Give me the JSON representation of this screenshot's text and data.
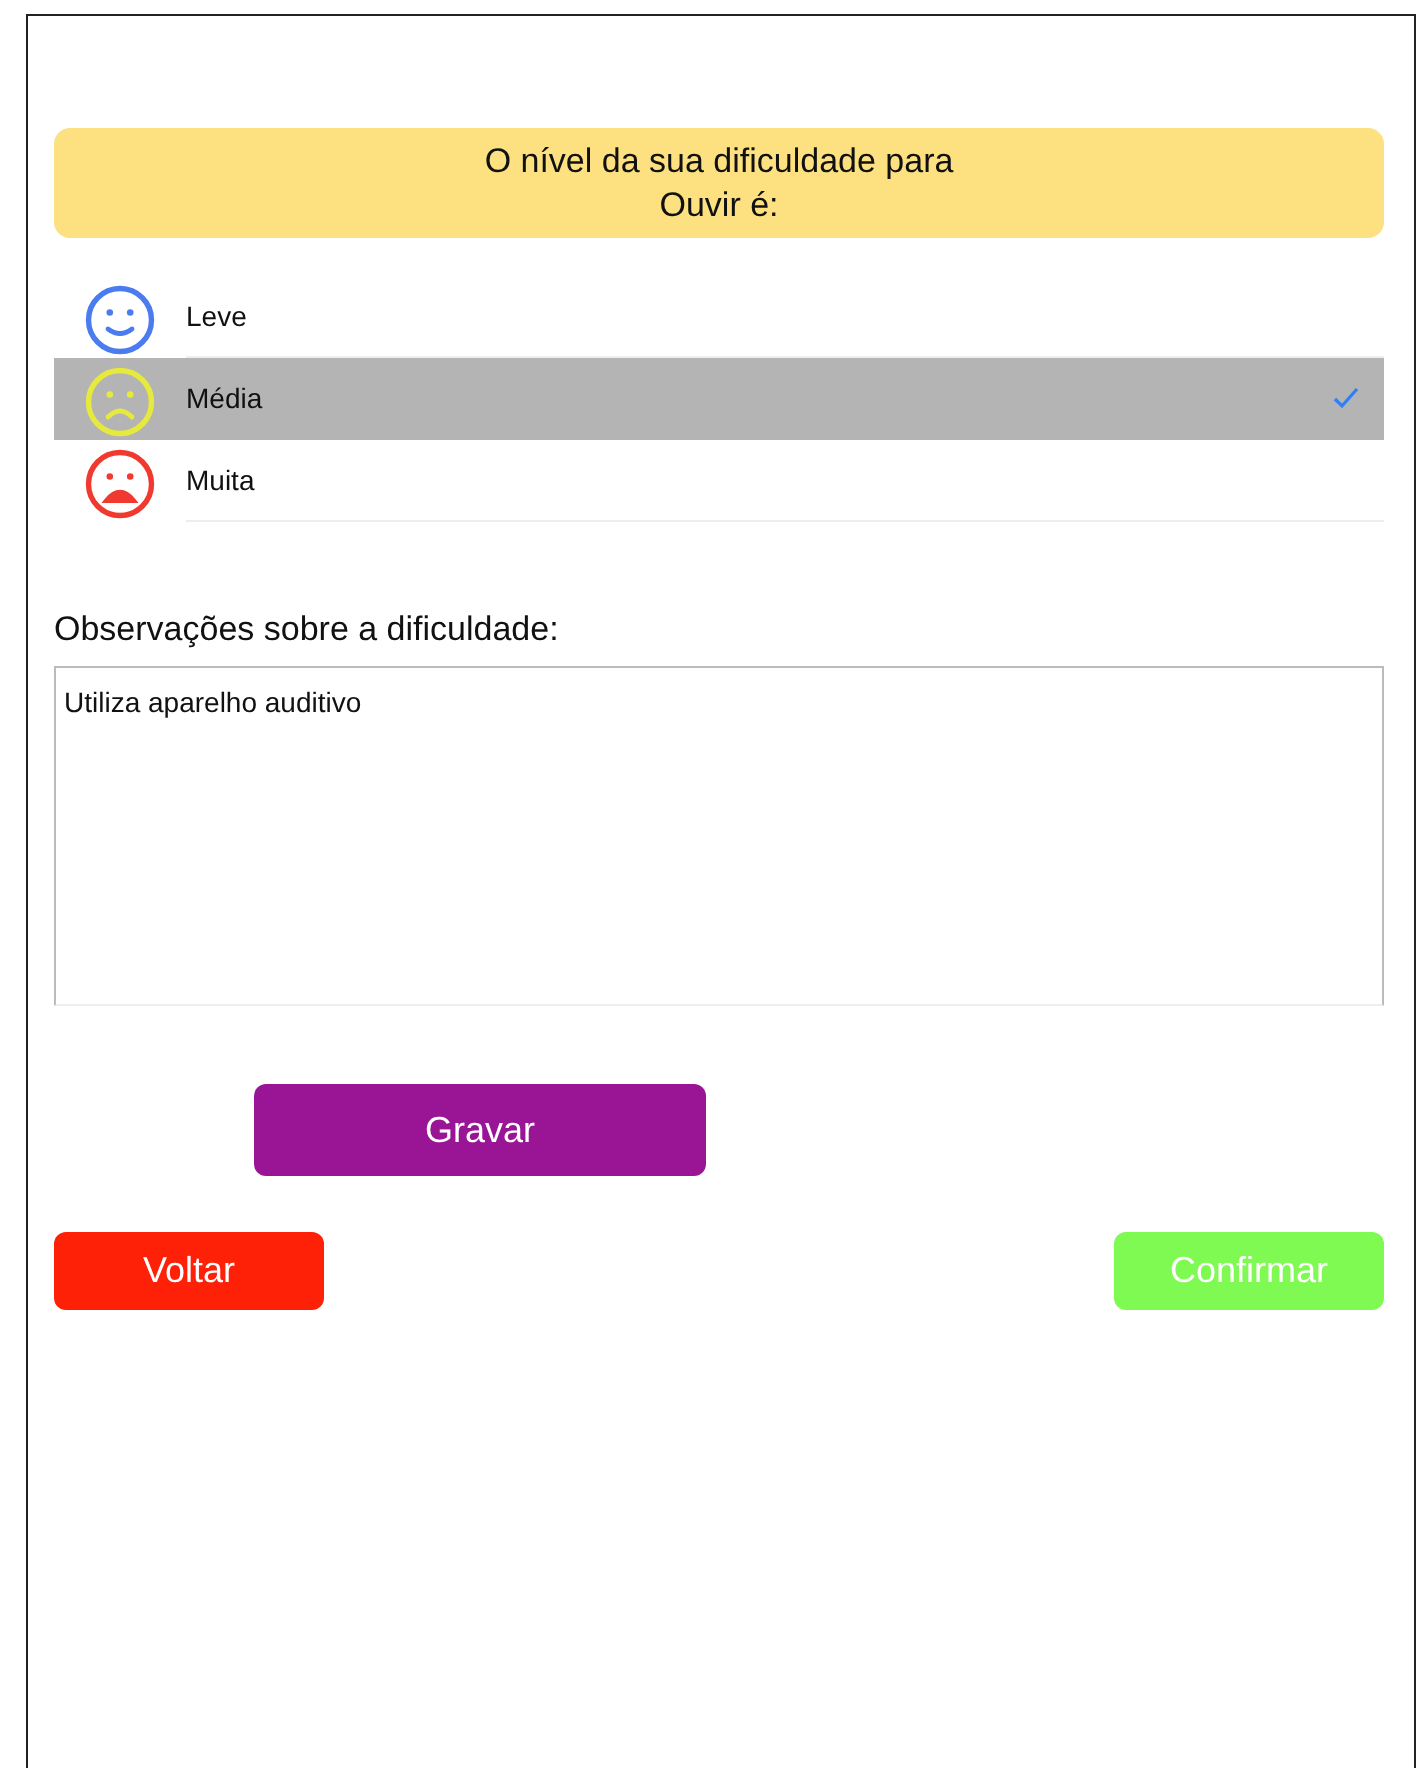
{
  "heading": {
    "lines": [
      "O nível da sua dificuldade para",
      "Ouvir é:"
    ]
  },
  "options": [
    {
      "label": "Leve",
      "kind": "happy",
      "color": "#4a7cf0",
      "selected": false
    },
    {
      "label": "Média",
      "kind": "sad",
      "color": "#e6ea3c",
      "selected": true
    },
    {
      "label": "Muita",
      "kind": "upset",
      "color": "#f03a30",
      "selected": false
    }
  ],
  "notes": {
    "label": "Observações sobre a dificuldade:",
    "value": "Utiliza aparelho auditivo"
  },
  "buttons": {
    "save": "Gravar",
    "back": "Voltar",
    "confirm": "Confirmar"
  }
}
